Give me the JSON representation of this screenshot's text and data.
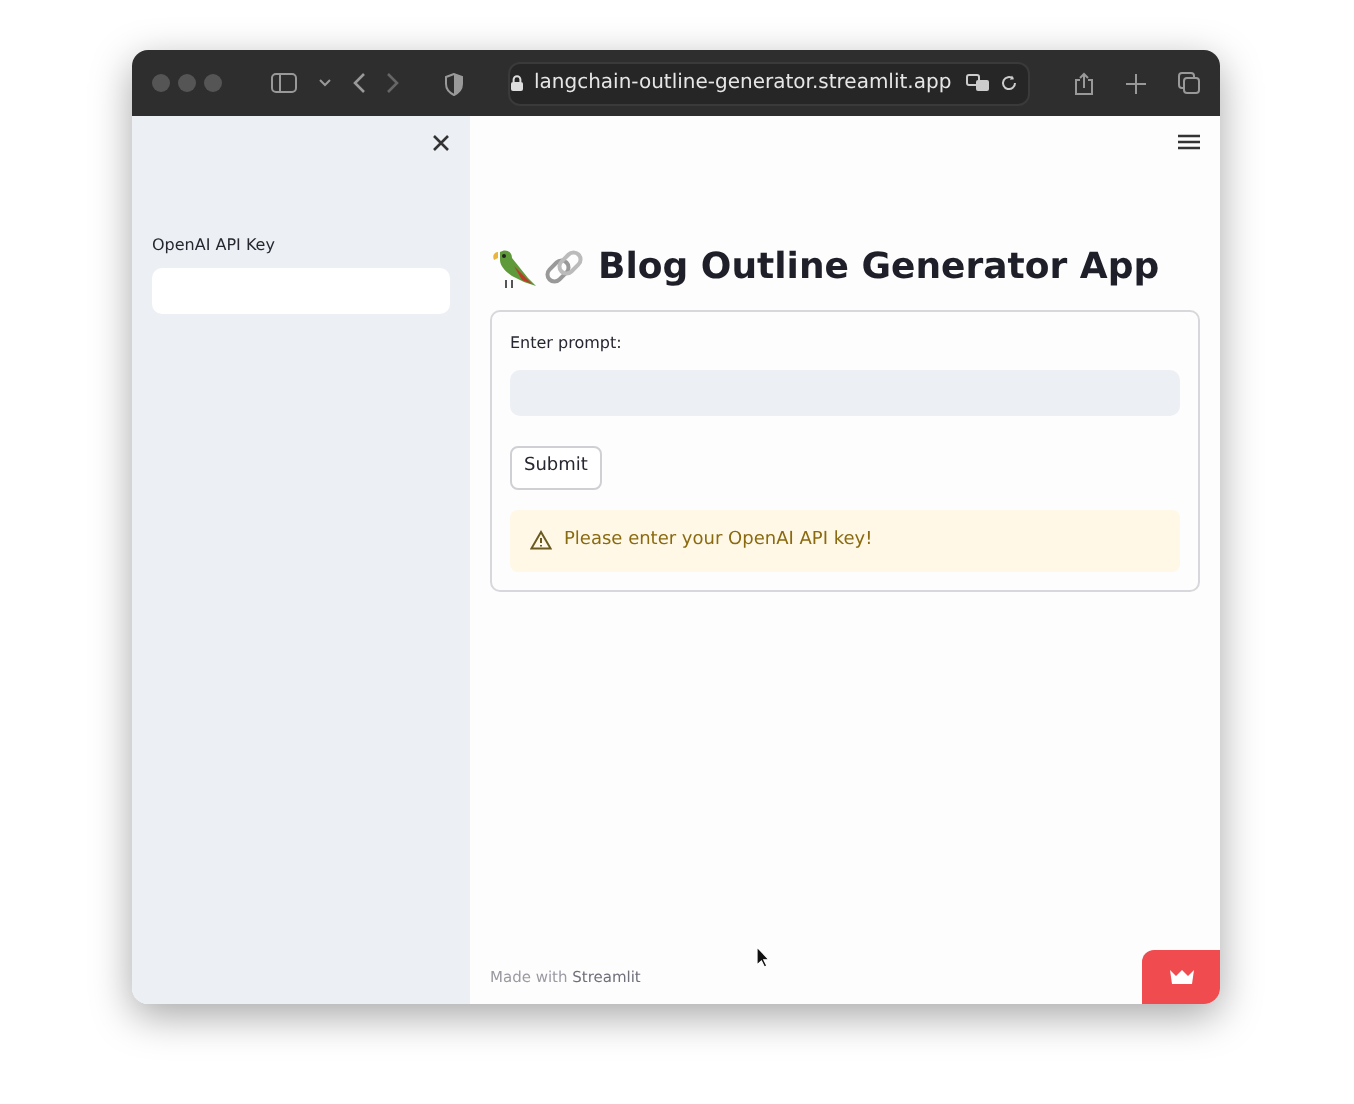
{
  "browser": {
    "url": "langchain-outline-generator.streamlit.app"
  },
  "sidebar": {
    "field_label": "OpenAI API Key"
  },
  "main": {
    "title": "Blog Outline Generator App",
    "form": {
      "label": "Enter prompt:",
      "button": "Submit",
      "warning": "Please enter your OpenAI API key!"
    },
    "footer": "Made with **Streamlit**"
  }
}
